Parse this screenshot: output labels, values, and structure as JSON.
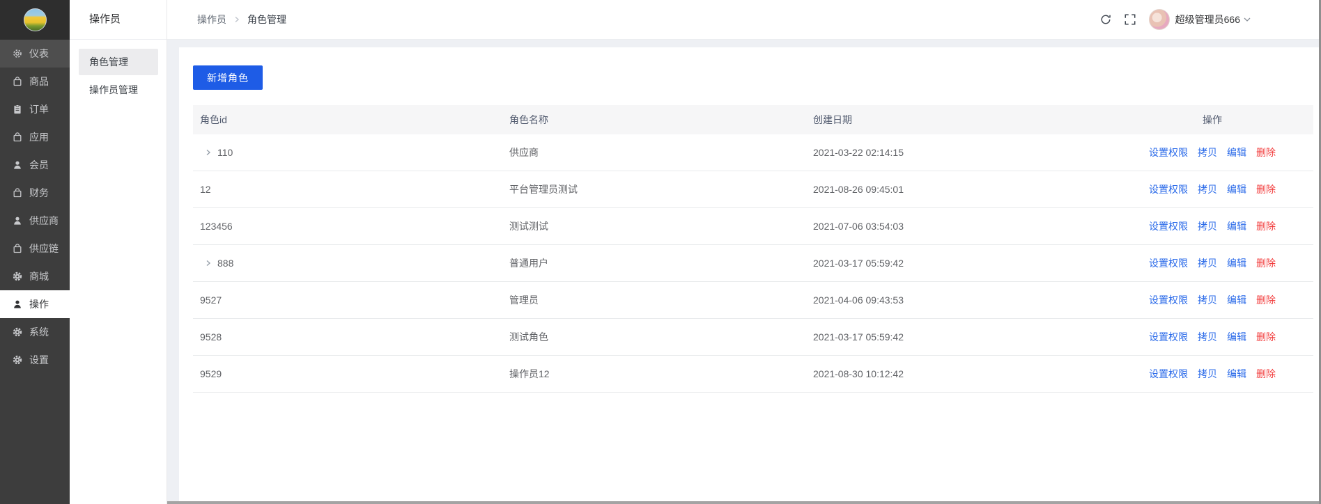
{
  "sidebar": {
    "items": [
      {
        "label": "仪表",
        "icon": "gauge-icon",
        "state": "highlighted"
      },
      {
        "label": "商品",
        "icon": "bag-icon",
        "state": "normal"
      },
      {
        "label": "订单",
        "icon": "clipboard-icon",
        "state": "normal"
      },
      {
        "label": "应用",
        "icon": "bag-icon",
        "state": "normal"
      },
      {
        "label": "会员",
        "icon": "user-icon",
        "state": "normal"
      },
      {
        "label": "财务",
        "icon": "bag-icon",
        "state": "normal"
      },
      {
        "label": "供应商",
        "icon": "user-icon",
        "state": "normal"
      },
      {
        "label": "供应链",
        "icon": "bag-icon",
        "state": "normal"
      },
      {
        "label": "商城",
        "icon": "gear-icon",
        "state": "normal"
      },
      {
        "label": "操作",
        "icon": "user-icon",
        "state": "active"
      },
      {
        "label": "系统",
        "icon": "gear-icon",
        "state": "normal"
      },
      {
        "label": "设置",
        "icon": "gear-icon",
        "state": "normal"
      }
    ]
  },
  "submenu": {
    "title": "操作员",
    "items": [
      {
        "label": "角色管理",
        "active": true
      },
      {
        "label": "操作员管理",
        "active": false
      }
    ]
  },
  "topbar": {
    "breadcrumb": [
      "操作员",
      "角色管理"
    ],
    "user_name": "超级管理员666"
  },
  "toolbar": {
    "add_role_label": "新增角色"
  },
  "table": {
    "columns": [
      "角色id",
      "角色名称",
      "创建日期",
      "操作"
    ],
    "action_labels": [
      "设置权限",
      "拷贝",
      "编辑",
      "删除"
    ],
    "rows": [
      {
        "id": "110",
        "expandable": true,
        "name": "供应商",
        "created": "2021-03-22 02:14:15"
      },
      {
        "id": "12",
        "expandable": false,
        "name": "平台管理员测试",
        "created": "2021-08-26 09:45:01"
      },
      {
        "id": "123456",
        "expandable": false,
        "name": "测试测试",
        "created": "2021-07-06 03:54:03"
      },
      {
        "id": "888",
        "expandable": true,
        "name": "普通用户",
        "created": "2021-03-17 05:59:42"
      },
      {
        "id": "9527",
        "expandable": false,
        "name": "管理员",
        "created": "2021-04-06 09:43:53"
      },
      {
        "id": "9528",
        "expandable": false,
        "name": "测试角色",
        "created": "2021-03-17 05:59:42"
      },
      {
        "id": "9529",
        "expandable": false,
        "name": "操作员12",
        "created": "2021-08-30 10:12:42"
      }
    ]
  },
  "colors": {
    "primary_button": "#1e5ce6",
    "action_link": "#2a6ae9",
    "danger_link": "#f23c3c",
    "sidebar_background": "#3d3d3d"
  }
}
